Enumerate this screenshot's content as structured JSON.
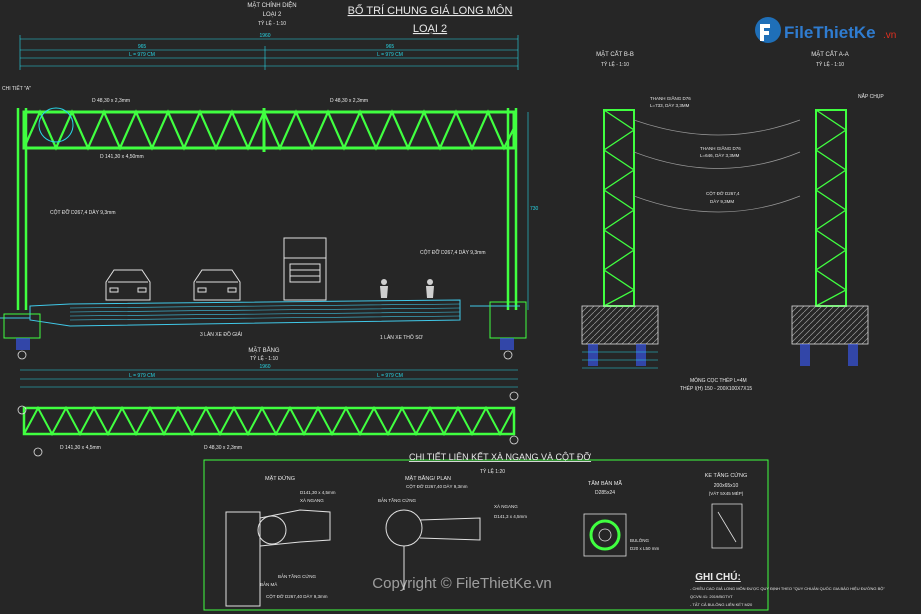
{
  "title": {
    "line1": "BỐ TRÍ CHUNG GIÁ LONG MÔN",
    "line2": "LOẠI 2"
  },
  "logo": {
    "text": "FileThietKe",
    "suffix": ".vn"
  },
  "front_view": {
    "title": "MẶT CHÍNH DIỆN",
    "subtitle": "LOẠI 2",
    "scale": "TỶ LỆ - 1:10",
    "detail": "CHI TIẾT \"A\"",
    "pipe_top": "D 48,30 x 2,3mm",
    "pipe_chord": "D 141,30 x 4,50mm",
    "column": "CỘT ĐỠ D267,4 DÀY 9,3mm",
    "column_right": "CỘT ĐỠ D267,4 DÀY 9,3mm",
    "lanes_left": "3 LÀN XE ĐỒ GIẢI",
    "lanes_right": "1 LÀN XE THÔ SƠ"
  },
  "plan_view": {
    "title": "MẶT BẰNG",
    "scale": "TỶ LỆ - 1:10",
    "pipe_a": "D 141,30 x 4,5mm",
    "pipe_b": "D 48,30 x 2,3mm"
  },
  "section_b": {
    "title": "MẶT CẮT B-B",
    "scale": "TỶ LỆ - 1:10",
    "bar1": "THANH GIẰNG D76",
    "bar1b": "L=733, DÀY 3,3MM",
    "bar2": "THANH GIẰNG D76",
    "bar2b": "L=646, DÀY 3,3MM",
    "column": "CỘT ĐỠ D267,4",
    "column2": "DÀY 9,3MM"
  },
  "section_a": {
    "title": "MẶT CẮT A-A",
    "scale": "TỶ LỆ - 1:10",
    "cap": "NẮP CHỤP"
  },
  "foundation_note": {
    "line1": "MÓNG CỌC THÉP L=4M",
    "line2": "THÉP I(H) 150 - 200X100X7X15"
  },
  "detail_section": {
    "title": "CHI TIẾT LIÊN KẾT XÀ NGANG VÀ CỘT ĐỠ",
    "scale": "TỶ LỆ 1:20",
    "elevation": {
      "title": "MẶT ĐỨNG",
      "a": "D141,30 x 4,5mm",
      "b": "XÀ NGANG",
      "c": "BẢN MÃ",
      "d": "CỘT ĐỠ D267,40 DÀY 9,3mm",
      "e": "BẢN TẦNG CỨNG"
    },
    "plan": {
      "title": "MẶT BẰNG/ PLAN",
      "a": "CỘT ĐỠ D267,40 DÀY 9,3mm",
      "b": "XÀ NGANG",
      "c": "D141,3 x 4,5mm",
      "d": "BẢN TẦNG CỨNG"
    },
    "plate": {
      "title": "TẤM BẢN MÃ",
      "size": "D285x24",
      "bolt": "BULÔNG",
      "bolt_spec": "D20 x L50 mm"
    },
    "stiffener": {
      "title": "KE TĂNG CỨNG",
      "size": "200x65x10",
      "note": "(VÁT 5X45 MÉP)"
    },
    "notes": {
      "title": "GHI CHÚ:",
      "line1": "- CHIỀU CAO GIÁ LONG MÔN ĐƯỢC QUY ĐỊNH THEO \"QUY CHUẨN QUỐC GIA BÁO HIỆU ĐƯỜNG BỘ\"",
      "line2": "QCVN 41: 2019/BGTVT",
      "line3": "- TẤT CẢ BULÔNG LIÊN KẾT M20"
    }
  },
  "dims": {
    "total_front": "1960",
    "half_left": "965",
    "half_right": "965",
    "span_left": "L = 979 CM",
    "span_right": "L = 979 CM",
    "height": "730",
    "total_plan": "1960"
  },
  "copyright": "Copyright © FileThietKe.vn",
  "colors": {
    "background": "#262626",
    "structure": "#40ff40",
    "dimension": "#28d8e8",
    "road": "#40c8e8",
    "title": "#ffffff"
  }
}
